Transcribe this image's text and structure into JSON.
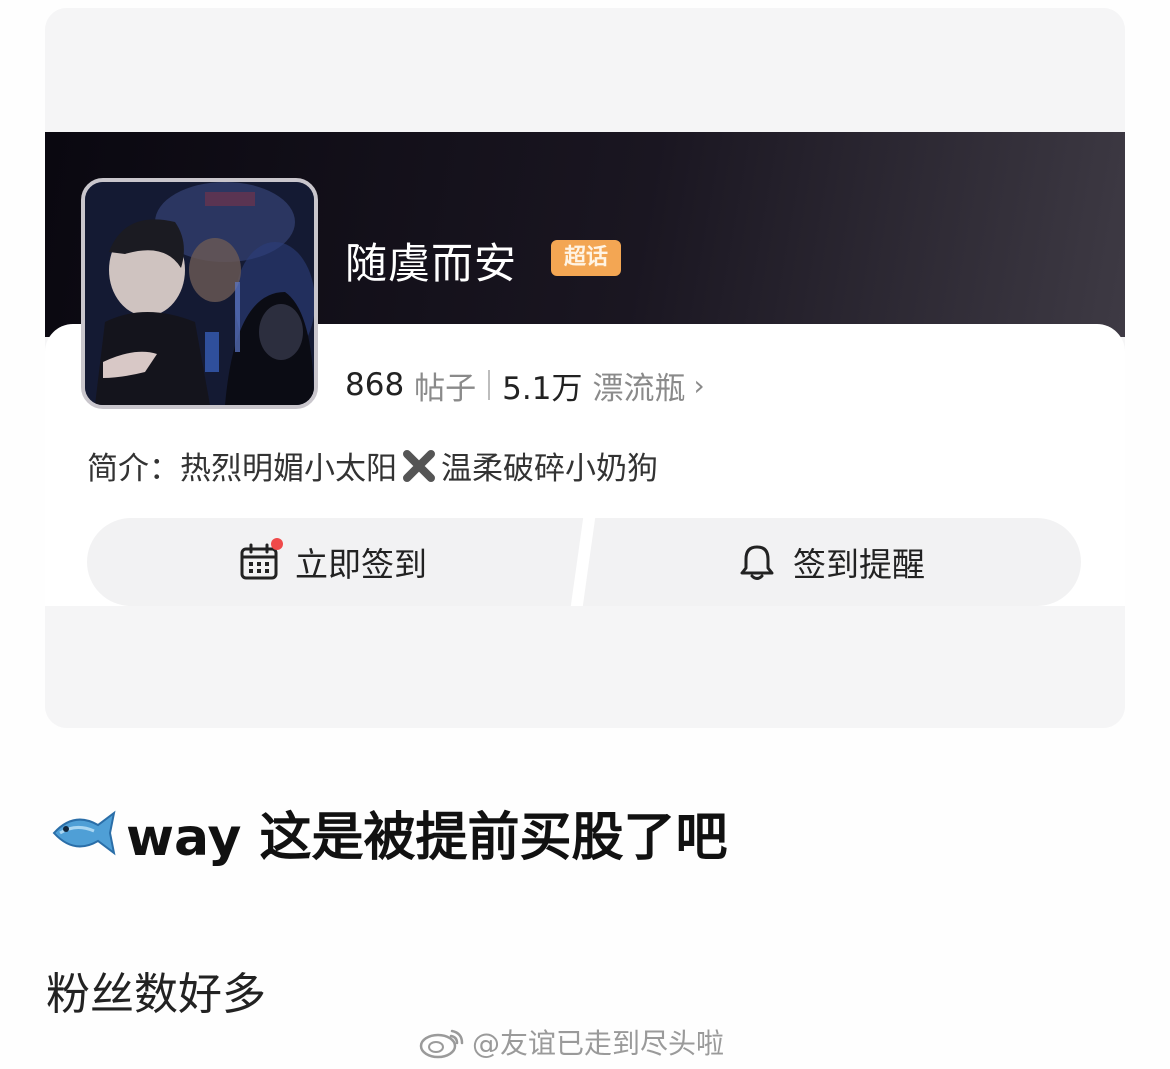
{
  "topic": {
    "name": "随虞而安",
    "badge": "超话",
    "posts_count": "868",
    "posts_label": "帖子",
    "bottles_count": "5.1万",
    "bottles_label": "漂流瓶",
    "chevron": "›",
    "intro_label": "简介：",
    "intro_part1": "热烈明媚小太阳",
    "intro_separator_icon": "cross-mark-icon",
    "intro_part2": "温柔破碎小奶狗"
  },
  "actions": {
    "checkin_label": "立即签到",
    "checkin_icon": "calendar-icon",
    "remind_label": "签到提醒",
    "remind_icon": "bell-icon"
  },
  "post": {
    "title_icon": "fish-icon",
    "title": "way 这是被提前买股了吧",
    "body": "粉丝数好多"
  },
  "watermark": {
    "text": "@友谊已走到尽头啦",
    "logo": "weibo-logo-icon"
  },
  "colors": {
    "badge": "#f3a653",
    "banner": "#0a0810",
    "red_dot": "#f04a4a",
    "panel": "#ffffff",
    "card_bg": "#f5f5f6"
  }
}
